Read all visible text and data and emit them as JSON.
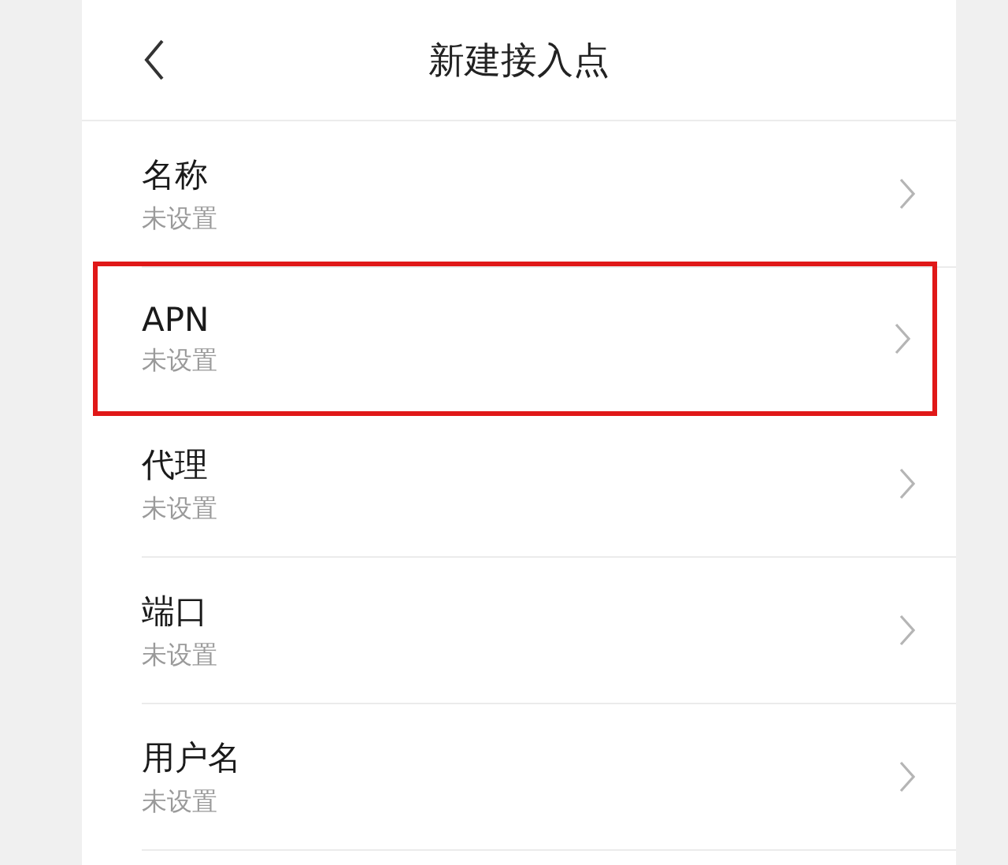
{
  "header": {
    "title": "新建接入点"
  },
  "rows": [
    {
      "label": "名称",
      "value": "未设置",
      "highlighted": false
    },
    {
      "label": "APN",
      "value": "未设置",
      "highlighted": true
    },
    {
      "label": "代理",
      "value": "未设置",
      "highlighted": false
    },
    {
      "label": "端口",
      "value": "未设置",
      "highlighted": false
    },
    {
      "label": "用户名",
      "value": "未设置",
      "highlighted": false
    }
  ]
}
